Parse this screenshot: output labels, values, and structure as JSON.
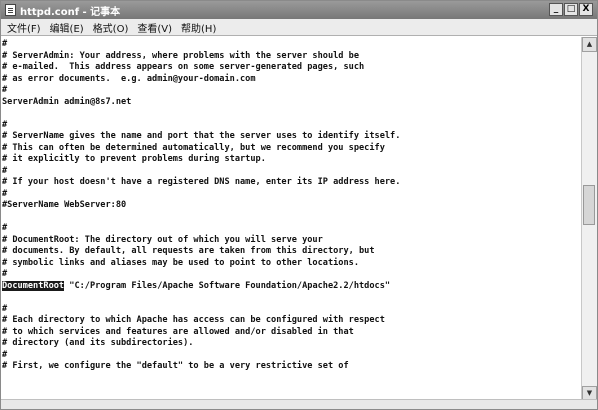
{
  "window": {
    "title": "httpd.conf - 记事本",
    "minimize_label": "_",
    "maximize_label": "□",
    "close_label": "X"
  },
  "menu": [
    {
      "label": "文件(F)"
    },
    {
      "label": "编辑(E)"
    },
    {
      "label": "格式(O)"
    },
    {
      "label": "查看(V)"
    },
    {
      "label": "帮助(H)"
    }
  ],
  "editor": {
    "selected_text": "DocumentRoot",
    "lines": [
      "#",
      "# ServerAdmin: Your address, where problems with the server should be",
      "# e-mailed.  This address appears on some server-generated pages, such",
      "# as error documents.  e.g. admin@your-domain.com",
      "#",
      "ServerAdmin admin@8s7.net",
      "",
      "#",
      "# ServerName gives the name and port that the server uses to identify itself.",
      "# This can often be determined automatically, but we recommend you specify",
      "# it explicitly to prevent problems during startup.",
      "#",
      "# If your host doesn't have a registered DNS name, enter its IP address here.",
      "#",
      "#ServerName WebServer:80",
      "",
      "#",
      "# DocumentRoot: The directory out of which you will serve your",
      "# documents. By default, all requests are taken from this directory, but",
      "# symbolic links and aliases may be used to point to other locations.",
      "#",
      "DocumentRoot \"C:/Program Files/Apache Software Foundation/Apache2.2/htdocs\"",
      "",
      "#",
      "# Each directory to which Apache has access can be configured with respect",
      "# to which services and features are allowed and/or disabled in that",
      "# directory (and its subdirectories).",
      "#",
      "# First, we configure the \"default\" to be a very restrictive set of"
    ]
  },
  "icons": {
    "app": "notepad-icon",
    "scroll_up": "arrow-up-icon",
    "scroll_down": "arrow-down-icon"
  }
}
